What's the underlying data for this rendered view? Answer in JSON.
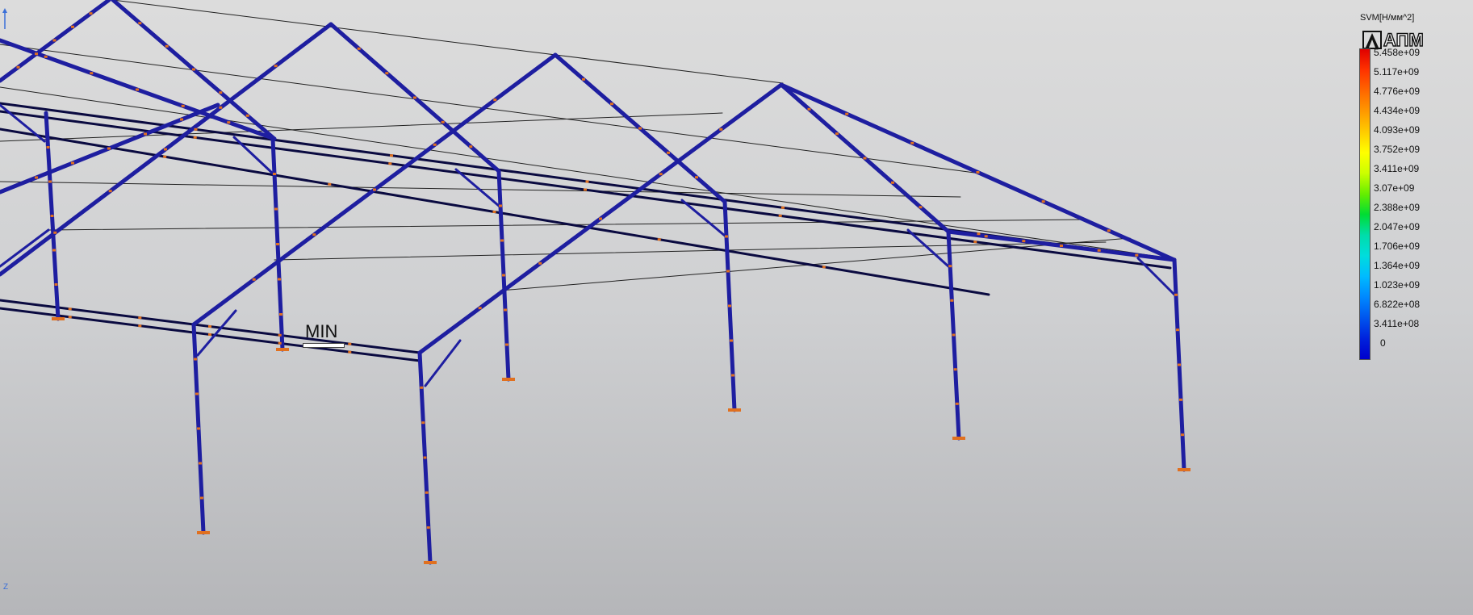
{
  "viewport": {
    "min_marker": "MIN",
    "axis_label": "Z"
  },
  "legend": {
    "title": "SVM[Н/мм^2]",
    "logo_text": "АПМ",
    "ticks": [
      "5.458e+09",
      "5.117e+09",
      "4.776e+09",
      "4.434e+09",
      "4.093e+09",
      "3.752e+09",
      "3.411e+09",
      "3.07e+09",
      "2.388e+09",
      "2.047e+09",
      "1.706e+09",
      "1.364e+09",
      "1.023e+09",
      "6.822e+08",
      "3.411e+08",
      "0"
    ],
    "colors": [
      "#e00000",
      "#ff3300",
      "#ff6600",
      "#ff9900",
      "#ffcc00",
      "#ffff00",
      "#ccff00",
      "#66ee00",
      "#00dd33",
      "#00ddaa",
      "#00dddd",
      "#00bbff",
      "#0088ff",
      "#0055ee",
      "#0022dd",
      "#0000cc"
    ]
  },
  "colors": {
    "member": "#1e1ea0",
    "member_edge": "#0a0a40",
    "tie": "#222222",
    "node": "#e07020"
  }
}
